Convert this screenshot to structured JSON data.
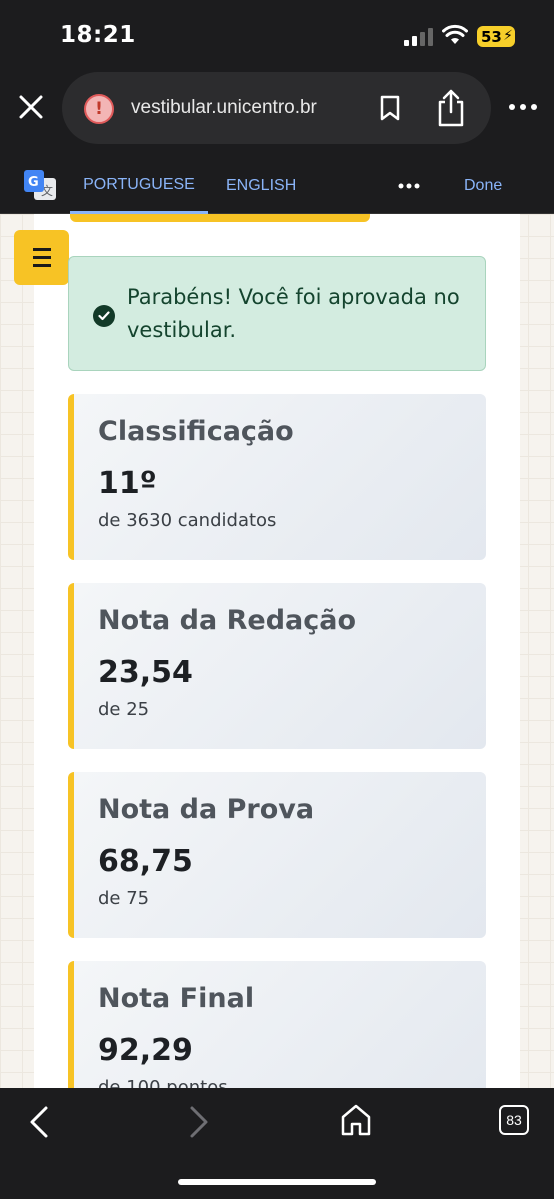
{
  "status_bar": {
    "time": "18:21",
    "battery": "53"
  },
  "browser": {
    "url": "vestibular.unicentro.br",
    "open_tabs": "83"
  },
  "translate_bar": {
    "tab_source": "PORTUGUESE",
    "tab_target": "ENGLISH",
    "done_label": "Done"
  },
  "alert": {
    "message": "Parabéns! Você foi aprovada no vestibular."
  },
  "stats": [
    {
      "label": "Classificação",
      "value": "11º",
      "sub": "de 3630 candidatos"
    },
    {
      "label": "Nota da Redação",
      "value": "23,54",
      "sub": "de 25"
    },
    {
      "label": "Nota da Prova",
      "value": "68,75",
      "sub": "de 75"
    },
    {
      "label": "Nota Final",
      "value": "92,29",
      "sub": "de 100 pontos"
    }
  ],
  "colors": {
    "accent": "#f7c325",
    "success_bg": "#d3ece0",
    "success_text": "#14442e",
    "link_blue": "#8ab4f8"
  },
  "icons": [
    "close-icon",
    "warning-icon",
    "bookmark-icon",
    "share-icon",
    "more-icon",
    "google-translate-icon",
    "menu-icon",
    "check-circle-icon",
    "back-icon",
    "forward-icon",
    "home-icon"
  ]
}
